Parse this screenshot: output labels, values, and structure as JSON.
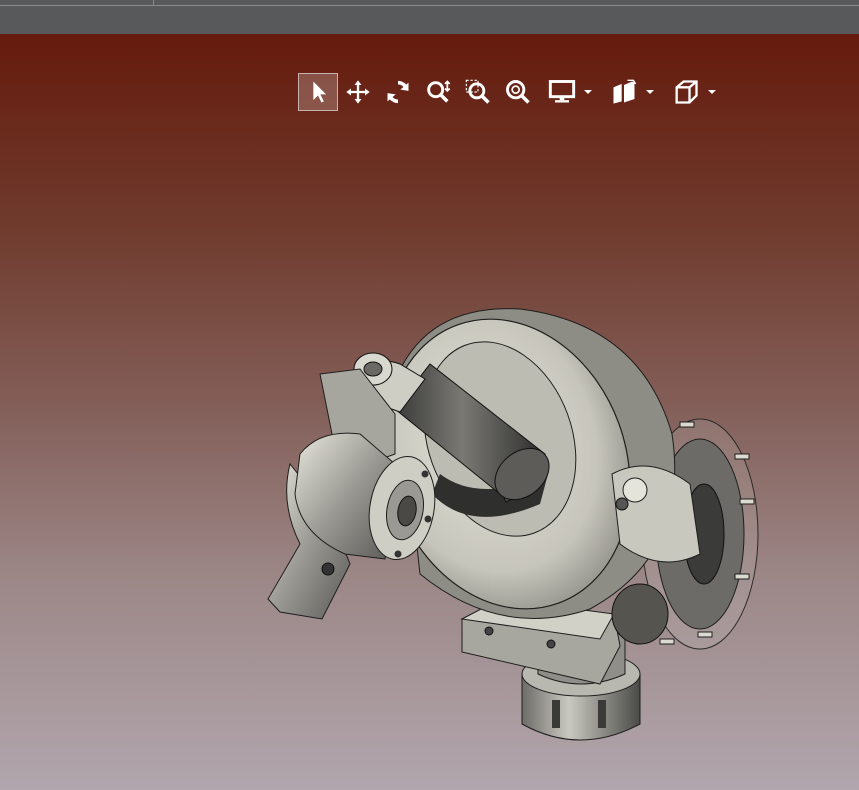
{
  "window": {
    "tabbar_color": "#58595b"
  },
  "viewport": {
    "background_top": "#651b0d",
    "background_bottom": "#b1a6ad"
  },
  "toolbar": {
    "items": [
      {
        "name": "select",
        "icon": "arrow-cursor-icon",
        "active": true
      },
      {
        "name": "pan",
        "icon": "move-arrows-icon",
        "active": false
      },
      {
        "name": "rotate",
        "icon": "rotate-icon",
        "active": false
      },
      {
        "name": "zoom",
        "icon": "zoom-icon",
        "active": false
      },
      {
        "name": "zoom-window",
        "icon": "zoom-window-icon",
        "active": false
      },
      {
        "name": "zoom-fit",
        "icon": "zoom-fit-icon",
        "active": false
      },
      {
        "name": "display",
        "icon": "monitor-icon",
        "active": false,
        "dropdown": true
      },
      {
        "name": "section",
        "icon": "section-view-icon",
        "active": false,
        "dropdown": true
      },
      {
        "name": "view-orientation",
        "icon": "cube-view-icon",
        "active": false,
        "dropdown": true
      }
    ],
    "accent": "#ffffff"
  },
  "model": {
    "name": "3d-assembly-model",
    "body_color": "#c6c5bb"
  }
}
